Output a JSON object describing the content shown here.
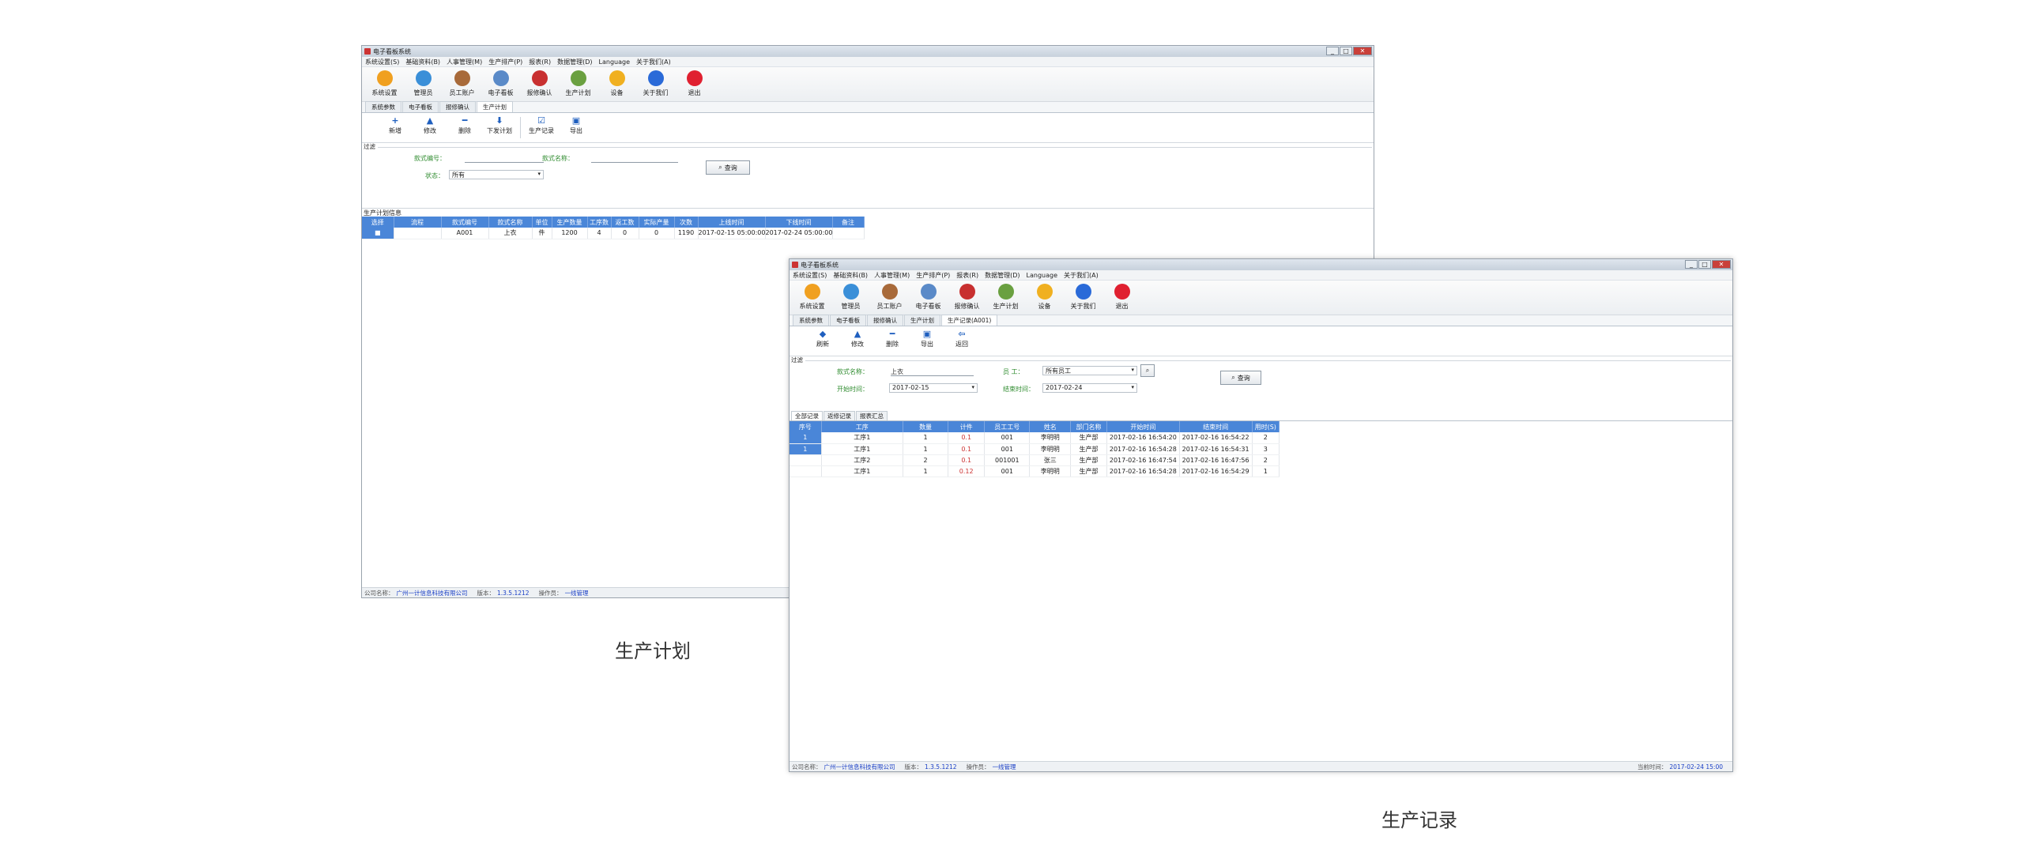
{
  "w1": {
    "title": "电子看板系统",
    "menu": [
      "系统设置(S)",
      "基础资料(B)",
      "人事管理(M)",
      "生产排产(P)",
      "报表(R)",
      "数据管理(D)",
      "Language",
      "关于我们(A)"
    ],
    "tools": [
      {
        "label": "系统设置",
        "icon": "settings-icon",
        "color": "#f0a020"
      },
      {
        "label": "管理员",
        "icon": "admin-icon",
        "color": "#3a8fd8"
      },
      {
        "label": "员工账户",
        "icon": "employees-icon",
        "color": "#a86a3a"
      },
      {
        "label": "电子看板",
        "icon": "monitor-icon",
        "color": "#5a8ac8"
      },
      {
        "label": "报修确认",
        "icon": "repair-icon",
        "color": "#c83030"
      },
      {
        "label": "生产计划",
        "icon": "plan-icon",
        "color": "#6aa040"
      },
      {
        "label": "设备",
        "icon": "device-icon",
        "color": "#f0b020"
      },
      {
        "label": "关于我们",
        "icon": "info-icon",
        "color": "#2a6ad8"
      },
      {
        "label": "退出",
        "icon": "exit-icon",
        "color": "#e02030"
      }
    ],
    "tabs": [
      "系统参数",
      "电子看板",
      "报修确认",
      "生产计划"
    ],
    "ops": [
      {
        "label": "新增",
        "glyph": "+"
      },
      {
        "label": "修改",
        "glyph": "▲"
      },
      {
        "label": "删除",
        "glyph": "━"
      },
      {
        "label": "下发计划",
        "glyph": "⬇"
      },
      {
        "label": "生产记录",
        "glyph": "☑"
      },
      {
        "label": "导出",
        "glyph": "▣"
      }
    ],
    "filter_label": "过滤",
    "f_style_no": "款式编号：",
    "f_style_name": "款式名称：",
    "f_status": "状态：",
    "f_status_value": "所有",
    "query": "查询",
    "grid_title": "生产计划信息",
    "columns": [
      "选择",
      "流程",
      "款式编号",
      "款式名称",
      "单位",
      "生产数量",
      "工序数",
      "返工数",
      "实际产量",
      "次数",
      "上线时间",
      "下线时间",
      "备注"
    ],
    "rows": [
      [
        "■",
        "",
        "A001",
        "上衣",
        "件",
        "1200",
        "4",
        "0",
        "0",
        "1190",
        "2017-02-15 05:00:00",
        "2017-02-24 05:00:00",
        ""
      ]
    ],
    "status": {
      "company_k": "公司名称：",
      "company_v": "广州一计信息科技有限公司",
      "ver_k": "版本：",
      "ver_v": "1.3.5.1212",
      "op_k": "操作员：",
      "op_v": "一线管理"
    },
    "caption": "生产计划"
  },
  "w2": {
    "title": "电子看板系统",
    "menu": [
      "系统设置(S)",
      "基础资料(B)",
      "人事管理(M)",
      "生产排产(P)",
      "报表(R)",
      "数据管理(D)",
      "Language",
      "关于我们(A)"
    ],
    "tools": [
      {
        "label": "系统设置",
        "icon": "settings-icon",
        "color": "#f0a020"
      },
      {
        "label": "管理员",
        "icon": "admin-icon",
        "color": "#3a8fd8"
      },
      {
        "label": "员工账户",
        "icon": "employees-icon",
        "color": "#a86a3a"
      },
      {
        "label": "电子看板",
        "icon": "monitor-icon",
        "color": "#5a8ac8"
      },
      {
        "label": "报修确认",
        "icon": "repair-icon",
        "color": "#c83030"
      },
      {
        "label": "生产计划",
        "icon": "plan-icon",
        "color": "#6aa040"
      },
      {
        "label": "设备",
        "icon": "device-icon",
        "color": "#f0b020"
      },
      {
        "label": "关于我们",
        "icon": "info-icon",
        "color": "#2a6ad8"
      },
      {
        "label": "退出",
        "icon": "exit-icon",
        "color": "#e02030"
      }
    ],
    "tabs": [
      "系统参数",
      "电子看板",
      "报修确认",
      "生产计划",
      "生产记录(A001)"
    ],
    "ops": [
      {
        "label": "刷新",
        "glyph": "◆"
      },
      {
        "label": "修改",
        "glyph": "▲"
      },
      {
        "label": "删除",
        "glyph": "━"
      },
      {
        "label": "导出",
        "glyph": "▣"
      },
      {
        "label": "返回",
        "glyph": "⇦"
      }
    ],
    "filter_label": "过滤",
    "f_style": "款式名称：",
    "f_style_value": "上衣",
    "f_emp": "员 工：",
    "f_emp_value": "所有员工",
    "f_start": "开始时间：",
    "f_start_value": "2017-02-15",
    "f_end": "结束时间：",
    "f_end_value": "2017-02-24",
    "query": "查询",
    "inner_tabs": [
      "全部记录",
      "返修记录",
      "报表汇总"
    ],
    "columns": [
      "序号",
      "工序",
      "数量",
      "计件",
      "员工工号",
      "姓名",
      "部门名称",
      "开始时间",
      "结束时间",
      "用时(S)"
    ],
    "rows": [
      [
        "1",
        "工序1",
        "1",
        "0.1",
        "001",
        "李明明",
        "生产部",
        "2017-02-16 16:54:20",
        "2017-02-16 16:54:22",
        "2"
      ],
      [
        "1",
        "工序1",
        "1",
        "0.1",
        "001",
        "李明明",
        "生产部",
        "2017-02-16 16:54:28",
        "2017-02-16 16:54:31",
        "3"
      ],
      [
        "",
        "工序2",
        "2",
        "0.1",
        "001001",
        "张三",
        "生产部",
        "2017-02-16 16:47:54",
        "2017-02-16 16:47:56",
        "2"
      ],
      [
        "",
        "工序1",
        "1",
        "0.12",
        "001",
        "李明明",
        "生产部",
        "2017-02-16 16:54:28",
        "2017-02-16 16:54:29",
        "1"
      ]
    ],
    "status": {
      "company_k": "公司名称：",
      "company_v": "广州一计信息科技有限公司",
      "ver_k": "版本：",
      "ver_v": "1.3.5.1212",
      "op_k": "操作员：",
      "op_v": "一线管理",
      "time_k": "当前时间：",
      "time_v": "2017-02-24 15:00"
    },
    "caption": "生产记录"
  }
}
